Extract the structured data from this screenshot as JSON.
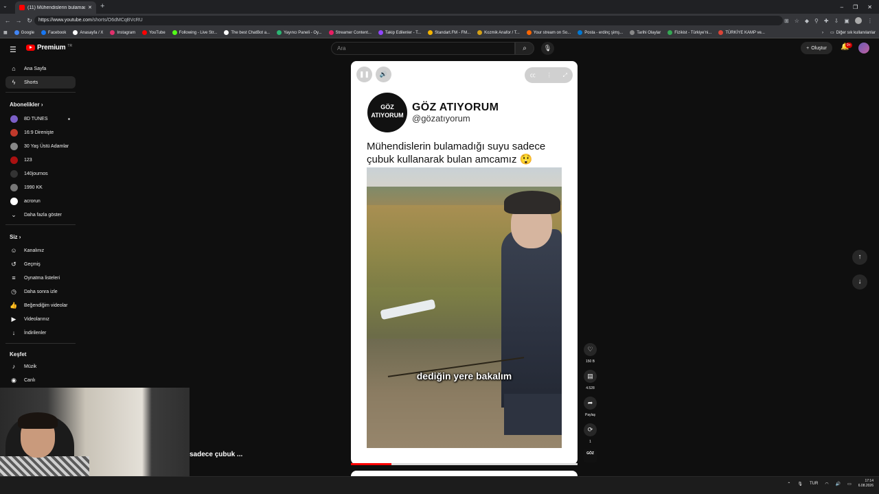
{
  "browser": {
    "tab_title": "(11) Mühendislerin bulamadı",
    "new_tab": "+",
    "url_host": "https://www.youtube.com",
    "url_path": "/shorts/O6dMCqBVcRU",
    "window_controls": [
      "–",
      "❐",
      "✕"
    ],
    "bookmarks": [
      {
        "label": "Google",
        "color": "#4285f4"
      },
      {
        "label": "Facebook",
        "color": "#1877f2"
      },
      {
        "label": "Anasayfa / X",
        "color": "#ffffff"
      },
      {
        "label": "Instagram",
        "color": "#e1306c"
      },
      {
        "label": "YouTube",
        "color": "#ff0000"
      },
      {
        "label": "Following - Live Str...",
        "color": "#53fc18"
      },
      {
        "label": "The best ChatBot a...",
        "color": "#ffffff"
      },
      {
        "label": "Yayıncı Paneli - Oy...",
        "color": "#2bb673"
      },
      {
        "label": "Streamer Content...",
        "color": "#e91e63"
      },
      {
        "label": "Takip Edilenler - T...",
        "color": "#9146ff"
      },
      {
        "label": "Standart.FM - FM...",
        "color": "#f4b400"
      },
      {
        "label": "Kozmik Anafor / T...",
        "color": "#d4a017"
      },
      {
        "label": "Your stream on So...",
        "color": "#ff6600"
      },
      {
        "label": "Posta - erdinç şimş...",
        "color": "#0078d4"
      },
      {
        "label": "Tarihi Olaylar",
        "color": "#888888"
      },
      {
        "label": "Fizikist - Türkiye'ni...",
        "color": "#34a853"
      },
      {
        "label": "TÜRKİYE KAMP ve...",
        "color": "#db4437"
      }
    ],
    "other_bookmarks": "Diğer yer işaretleri",
    "other_users": "Diğer sık kullanılanlar"
  },
  "header": {
    "logo_text": "Premium",
    "logo_suffix": "TR",
    "search_placeholder": "Ara",
    "create_label": "Oluştur",
    "notif_count": "9+"
  },
  "sidebar": {
    "main": [
      {
        "label": "Ana Sayfa",
        "icon": "home-icon",
        "glyph": "⌂"
      },
      {
        "label": "Shorts",
        "icon": "shorts-icon",
        "glyph": "ϟ",
        "active": true
      }
    ],
    "subs_title": "Abonelikler",
    "subs": [
      {
        "label": "8D TUNES",
        "color": "#7b5fc7",
        "dot": true
      },
      {
        "label": "16:9 Direnişte",
        "color": "#c0392b"
      },
      {
        "label": "30 Yaş Üstü Adamlar",
        "color": "#888888"
      },
      {
        "label": "123",
        "color": "#aa1111"
      },
      {
        "label": "140journos",
        "color": "#333333"
      },
      {
        "label": "1990 KK",
        "color": "#777777"
      },
      {
        "label": "acrorun",
        "color": "#ffffff"
      }
    ],
    "show_more": "Daha fazla göster",
    "you_title": "Siz",
    "you": [
      {
        "label": "Kanalınız",
        "icon": "channel-icon",
        "glyph": "☺"
      },
      {
        "label": "Geçmiş",
        "icon": "history-icon",
        "glyph": "↺"
      },
      {
        "label": "Oynatma listeleri",
        "icon": "playlists-icon",
        "glyph": "≡"
      },
      {
        "label": "Daha sonra izle",
        "icon": "watch-later-icon",
        "glyph": "◷"
      },
      {
        "label": "Beğendiğim videolar",
        "icon": "liked-icon",
        "glyph": "👍"
      },
      {
        "label": "Videolarınız",
        "icon": "your-videos-icon",
        "glyph": "▶"
      },
      {
        "label": "İndirilenler",
        "icon": "downloads-icon",
        "glyph": "↓"
      }
    ],
    "explore_title": "Keşfet",
    "explore": [
      {
        "label": "Müzik",
        "icon": "music-icon",
        "glyph": "♪"
      },
      {
        "label": "Canlı",
        "icon": "live-icon",
        "glyph": "◉"
      }
    ]
  },
  "short": {
    "channel_logo_top": "GÖZ",
    "channel_logo_bottom": "ATIYORUM",
    "channel_name": "GÖZ ATIYORUM",
    "channel_handle": "@gözatıyorum",
    "caption": "Mühendislerin bulamadığı suyu sadece çubuk kullanarak bulan amcamız 😲",
    "subtitle": "dediğin yere bakalım",
    "progress": 0.18
  },
  "actions": {
    "likes": "150 B",
    "comments": "4.528",
    "share": "Paylaş",
    "remix": "1",
    "channel_thumb": "GÖZ"
  },
  "overlay_text": "sadece çubuk ...",
  "taskbar": {
    "lang": "TUR",
    "time": "17:14",
    "date": "6.08.2026"
  }
}
